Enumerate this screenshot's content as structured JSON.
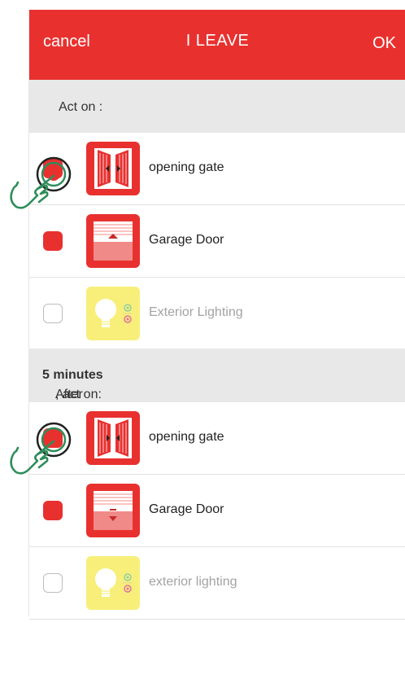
{
  "header": {
    "cancel_label": "cancel",
    "title": "I LEAVE",
    "ok_label": "OK"
  },
  "section1": {
    "title": "Act on :",
    "items": [
      {
        "label": "opening gate",
        "checked": true,
        "icon": "gate-icon"
      },
      {
        "label": "Garage Door",
        "checked": true,
        "icon": "garage-door-up-icon"
      },
      {
        "label": "Exterior Lighting",
        "checked": false,
        "icon": "lighting-icon"
      }
    ]
  },
  "section2": {
    "title_prefix": "After ",
    "title_bold": "5 minutes",
    "title_suffix": ", act on:",
    "items": [
      {
        "label": "opening gate",
        "checked": true,
        "icon": "gate-icon"
      },
      {
        "label": "Garage Door",
        "checked": true,
        "icon": "garage-door-down-icon"
      },
      {
        "label": "exterior lighting",
        "checked": false,
        "icon": "lighting-icon"
      }
    ]
  },
  "colors": {
    "accent": "#e8312f",
    "section_bg": "#e8e8e8",
    "light_icon": "#f7ef7a"
  }
}
